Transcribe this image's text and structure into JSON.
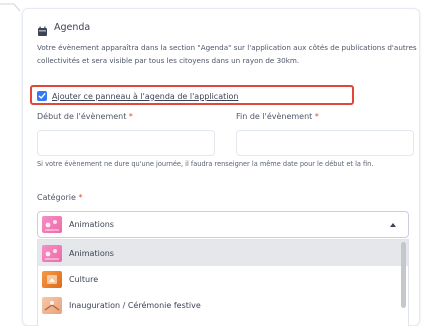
{
  "agenda": {
    "title": "Agenda",
    "icon": "calendar-icon",
    "description": "Votre évènement apparaîtra dans la section \"Agenda\" sur l'application aux côtés de publications d'autres collectivités et sera visible par tous les citoyens dans un rayon de 30km.",
    "checkbox": {
      "label": "Ajouter ce panneau à l'agenda de l'application",
      "checked": true
    }
  },
  "dates": {
    "start_label": "Début de l'évènement",
    "end_label": "Fin de l'évènement",
    "required_mark": "*",
    "start_value": "",
    "end_value": "",
    "hint": "Si votre évènement ne dure qu'une journée, il faudra renseigner la même date pour le début et la fin."
  },
  "category": {
    "label": "Catégorie",
    "required_mark": "*",
    "selected": "Animations",
    "options": [
      {
        "label": "Animations",
        "icon": "animations-icon"
      },
      {
        "label": "Culture",
        "icon": "culture-icon"
      },
      {
        "label": "Inauguration / Cérémonie festive",
        "icon": "inauguration-icon"
      }
    ]
  },
  "colors": {
    "accent": "#3478f6",
    "highlight": "#e0463a",
    "required": "#e0463a"
  }
}
